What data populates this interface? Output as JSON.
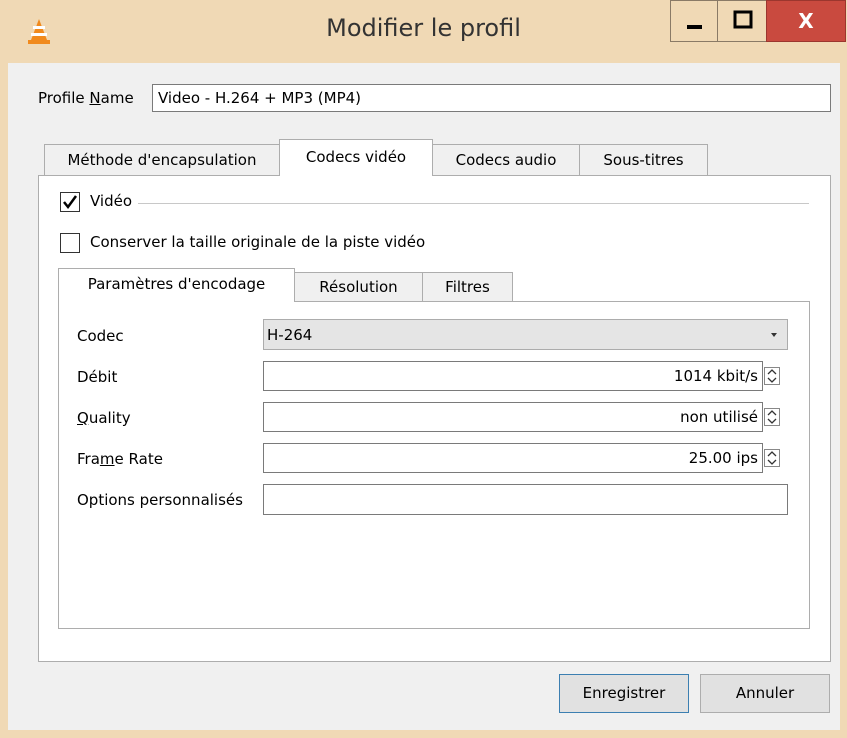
{
  "window": {
    "title": "Modifier le profil",
    "close_glyph": "X"
  },
  "profile": {
    "label": "Profile Name",
    "value": "Video - H.264 + MP3 (MP4)"
  },
  "tabs": [
    {
      "label": "Méthode d'encapsulation"
    },
    {
      "label": "Codecs vidéo"
    },
    {
      "label": "Codecs audio"
    },
    {
      "label": "Sous-titres"
    }
  ],
  "video": {
    "enabled_label": "Vidéo",
    "enabled": true,
    "keep_size_label": "Conserver la taille originale de la piste vidéo",
    "keep_size": false
  },
  "subtabs": [
    {
      "label": "Paramètres d'encodage"
    },
    {
      "label": "Résolution"
    },
    {
      "label": "Filtres"
    }
  ],
  "encoding": {
    "codec_label": "Codec",
    "codec_value": "H-264",
    "bitrate_label": "Débit",
    "bitrate_value": "1014 kbit/s",
    "quality_label": "Quality",
    "quality_value": "non utilisé",
    "framerate_label": "Frame Rate",
    "framerate_value": "25.00 ips",
    "custom_label": "Options personnalisés",
    "custom_value": ""
  },
  "buttons": {
    "save": "Enregistrer",
    "cancel": "Annuler"
  },
  "colors": {
    "titlebar": "#f0d9b5",
    "close": "#c94a3f",
    "accent_border": "#3c7fb1"
  }
}
